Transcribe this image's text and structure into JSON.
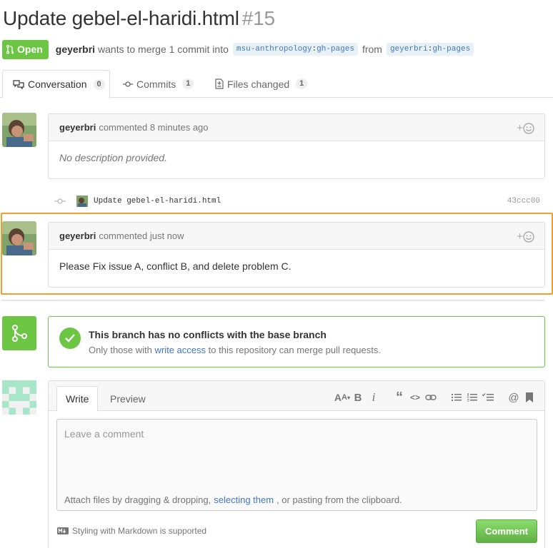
{
  "pr": {
    "title": "Update gebel-el-haridi.html",
    "number": "#15",
    "state": "Open",
    "author": "geyerbri",
    "merge_text": "wants to merge 1 commit into",
    "base_user": "msu-anthropology",
    "base_branch": "gh-pages",
    "from_text": "from",
    "head_user": "geyerbri",
    "head_branch": "gh-pages"
  },
  "tabs": [
    {
      "label": "Conversation",
      "count": "0"
    },
    {
      "label": "Commits",
      "count": "1"
    },
    {
      "label": "Files changed",
      "count": "1"
    }
  ],
  "comments": [
    {
      "author": "geyerbri",
      "action": "commented 8 minutes ago",
      "body": "No description provided."
    },
    {
      "author": "geyerbri",
      "action": "commented just now",
      "body": "Please Fix issue A, conflict B, and delete problem C."
    }
  ],
  "commit": {
    "message": "Update gebel-el-haridi.html",
    "sha": "43ccc00"
  },
  "merge": {
    "heading": "This branch has no conflicts with the base branch",
    "sub_before": "Only those with",
    "sub_link": "write access",
    "sub_after": "to this repository can merge pull requests."
  },
  "editor": {
    "tab_write": "Write",
    "tab_preview": "Preview",
    "placeholder": "Leave a comment",
    "attach_before": "Attach files by dragging & dropping,",
    "attach_link": "selecting them",
    "attach_after": ", or pasting from the clipboard.",
    "markdown_note": "Styling with Markdown is supported",
    "submit": "Comment"
  },
  "colors": {
    "green": "#6cc644",
    "link": "#4078c0",
    "highlight": "#f0a030"
  },
  "icons": [
    "pull-request-icon",
    "comment-discussion-icon",
    "commit-icon",
    "file-diff-icon",
    "smiley-icon",
    "merge-icon",
    "check-icon",
    "markdown-icon"
  ]
}
